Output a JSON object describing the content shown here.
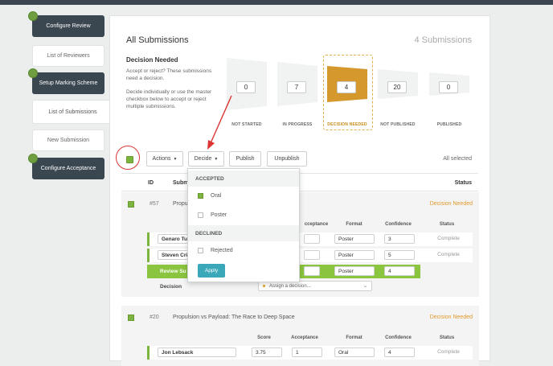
{
  "sidebar": {
    "items": [
      {
        "label": "Configure Review"
      },
      {
        "label": "List of Reviewers"
      },
      {
        "label": "Setup Marking Scheme"
      },
      {
        "label": "List of Submissions"
      },
      {
        "label": "New Submission"
      },
      {
        "label": "Configure Acceptance"
      }
    ]
  },
  "header": {
    "title": "All Submissions",
    "count": "4 Submissions"
  },
  "decision_needed": {
    "title": "Decision Needed",
    "desc1": "Accept or reject? These submissions need a decision.",
    "desc2": "Decide individually or use the master checkbox below to accept or reject multiple submissions."
  },
  "stages": [
    {
      "label": "NOT STARTED",
      "value": "0"
    },
    {
      "label": "IN PROGRESS",
      "value": "7"
    },
    {
      "label": "DECISION NEEDED",
      "value": "4"
    },
    {
      "label": "NOT PUBLISHED",
      "value": "20"
    },
    {
      "label": "PUBLISHED",
      "value": "0"
    }
  ],
  "toolbar": {
    "actions": "Actions",
    "decide": "Decide",
    "publish": "Publish",
    "unpublish": "Unpublish",
    "all_selected": "All selected"
  },
  "table": {
    "col_id": "ID",
    "col_sub": "Subm",
    "col_status": "Status"
  },
  "dropdown": {
    "accepted": "ACCEPTED",
    "oral": "Oral",
    "poster": "Poster",
    "declined": "DECLINED",
    "rejected": "Rejected",
    "apply": "Apply"
  },
  "sub1": {
    "id": "#57",
    "title": "Propu",
    "status": "Decision Needed",
    "h_acceptance": "cceptance",
    "h_format": "Format",
    "h_confidence": "Confidence",
    "h_status": "Status",
    "rows": [
      {
        "name": "Genaro Tu",
        "format": "Poster",
        "confidence": "3",
        "status": "Complete"
      },
      {
        "name": "Steven Cri",
        "format": "Poster",
        "confidence": "5",
        "status": "Complete"
      }
    ],
    "review_label": "Review Su",
    "review_format": "Poster",
    "review_confidence": "4",
    "decision_label": "Decision",
    "decision_placeholder": "Assign a decision..."
  },
  "sub2": {
    "id": "#20",
    "title": "Propulsion vs Payload: The Race to Deep Space",
    "status": "Decision Needed",
    "h_score": "Score",
    "h_acceptance": "Acceptance",
    "h_format": "Format",
    "h_confidence": "Confidence",
    "h_status": "Status",
    "row": {
      "name": "Jon Lebsack",
      "score": "3.75",
      "acceptance": "1",
      "format": "Oral",
      "confidence": "4",
      "status": "Complete"
    }
  },
  "colors": {
    "accent_green": "#7db33f",
    "decision_orange": "#d4982c",
    "apply_teal": "#3aa8b8",
    "sidebar_dark": "#3a4650"
  }
}
